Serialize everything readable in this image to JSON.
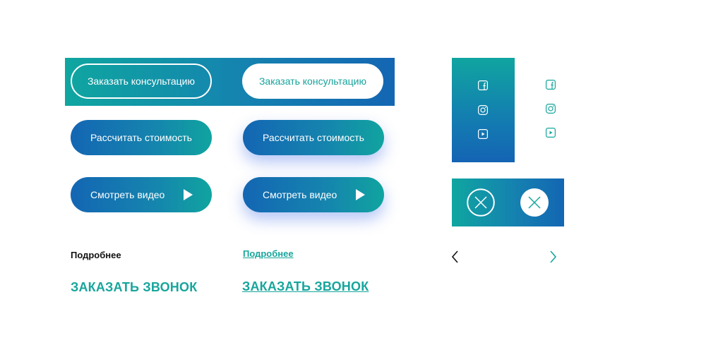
{
  "buttons": {
    "consult_outline": "Заказать консультацию",
    "consult_white": "Заказать консультацию",
    "cost": "Рассчитать стоимость",
    "cost_shadow": "Рассчитать стоимость",
    "video": "Смотреть видео",
    "video_shadow": "Смотреть видео"
  },
  "links": {
    "more": "Подробнее",
    "more_hover": "Подробнее",
    "call": "ЗАКАЗАТЬ ЗВОНОК",
    "call_hover": "ЗАКАЗАТЬ ЗВОНОК"
  },
  "icons": [
    "facebook-icon",
    "instagram-icon",
    "youtube-icon",
    "close-icon",
    "chevron-left-icon",
    "chevron-right-icon",
    "play-icon"
  ],
  "colors": {
    "teal": "#17a59c",
    "blue": "#1466b3",
    "text_dark": "#111111",
    "white": "#ffffff"
  }
}
